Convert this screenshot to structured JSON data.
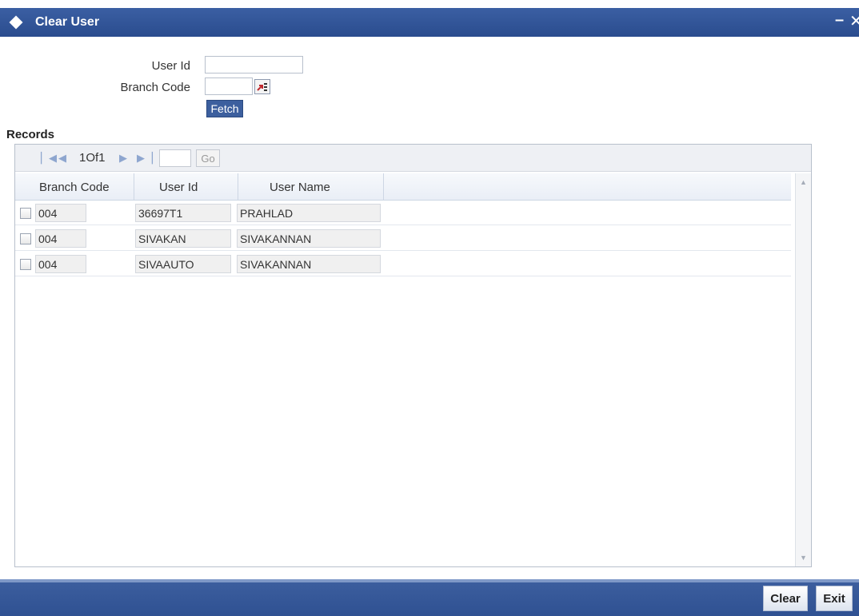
{
  "window": {
    "title": "Clear User",
    "minimize_label": "–",
    "close_label": "✕"
  },
  "form": {
    "user_id_label": "User Id",
    "user_id_value": "",
    "branch_code_label": "Branch Code",
    "branch_code_value": "",
    "lov_icon": "list-of-values-icon",
    "fetch_label": "Fetch"
  },
  "records": {
    "title": "Records",
    "pager": {
      "info": "1Of1",
      "page_value": "",
      "go_label": "Go"
    },
    "columns": [
      "Branch Code",
      "User Id",
      "User Name"
    ],
    "rows": [
      {
        "branch_code": "004",
        "user_id": "36697T1",
        "user_name": "PRAHLAD",
        "checked": false
      },
      {
        "branch_code": "004",
        "user_id": "SIVAKAN",
        "user_name": "SIVAKANNAN",
        "checked": false
      },
      {
        "branch_code": "004",
        "user_id": "SIVAAUTO",
        "user_name": "SIVAKANNAN",
        "checked": false
      }
    ]
  },
  "footer": {
    "clear_label": "Clear",
    "exit_label": "Exit"
  },
  "colors": {
    "titlebar": "#2a4c8e",
    "footer": "#2f5192",
    "fetch_button": "#3c5f9e"
  }
}
